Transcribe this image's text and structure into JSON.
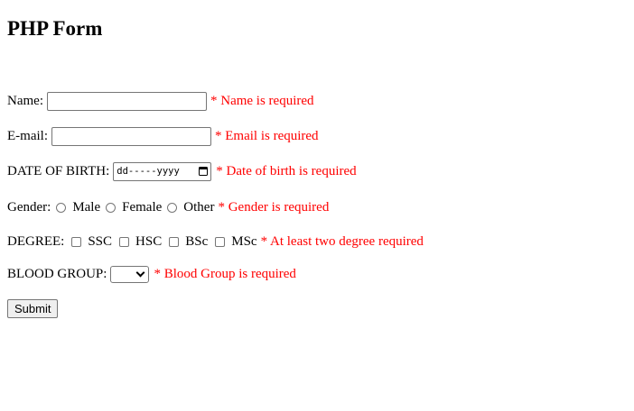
{
  "form": {
    "title": "PHP Form",
    "name": {
      "label": "Name:",
      "value": "",
      "error": "* Name is required"
    },
    "email": {
      "label": "E-mail:",
      "value": "",
      "error": "* Email is required"
    },
    "dob": {
      "label": "DATE OF BIRTH:",
      "placeholder": "dd-----yyyy",
      "error": "* Date of birth is required"
    },
    "gender": {
      "label": "Gender:",
      "options": [
        "Male",
        "Female",
        "Other"
      ],
      "error": "* Gender is required"
    },
    "degree": {
      "label": "DEGREE:",
      "options": [
        "SSC",
        "HSC",
        "BSc",
        "MSc"
      ],
      "error": "* At least two degree required"
    },
    "blood_group": {
      "label": "BLOOD GROUP:",
      "selected": "",
      "error": "* Blood Group is required"
    },
    "submit_label": "Submit"
  },
  "colors": {
    "error": "#ff0000",
    "border": "#767676",
    "button_bg": "#efefef"
  },
  "icons": {
    "date_picker": "calendar-icon",
    "select": "chevron-down-icon"
  }
}
